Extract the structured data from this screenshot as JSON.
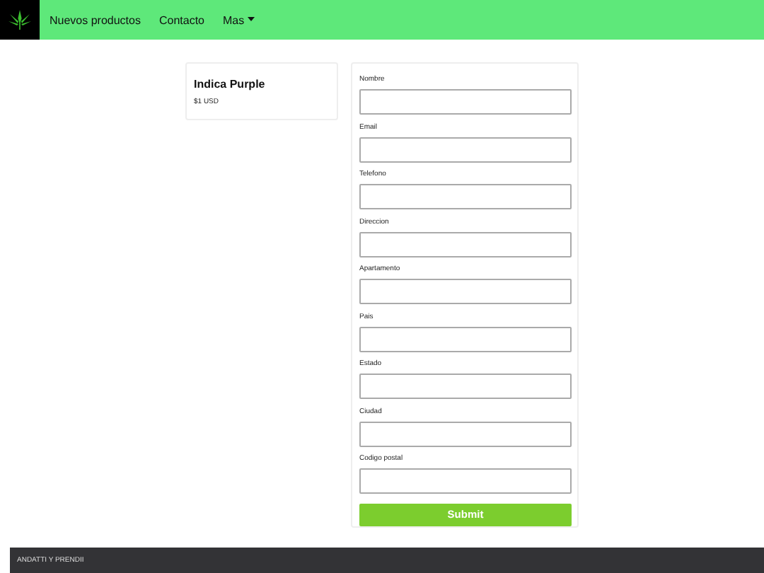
{
  "nav": {
    "items": [
      {
        "label": "Nuevos productos",
        "kind": "link"
      },
      {
        "label": "Contacto",
        "kind": "link"
      },
      {
        "label": "Mas",
        "kind": "dropdown"
      }
    ]
  },
  "product": {
    "name": "Indica Purple",
    "price": "$1 USD"
  },
  "form": {
    "fields": [
      {
        "label": "Nombre"
      },
      {
        "label": "Email"
      },
      {
        "label": "Telefono"
      },
      {
        "label": "Direccion"
      },
      {
        "label": "Apartamento"
      },
      {
        "label": "Pais"
      },
      {
        "label": "Estado"
      },
      {
        "label": "Ciudad"
      },
      {
        "label": "Codigo postal"
      }
    ],
    "submit": "Submit"
  },
  "footer": {
    "text": "ANDATTI Y PRENDII"
  }
}
